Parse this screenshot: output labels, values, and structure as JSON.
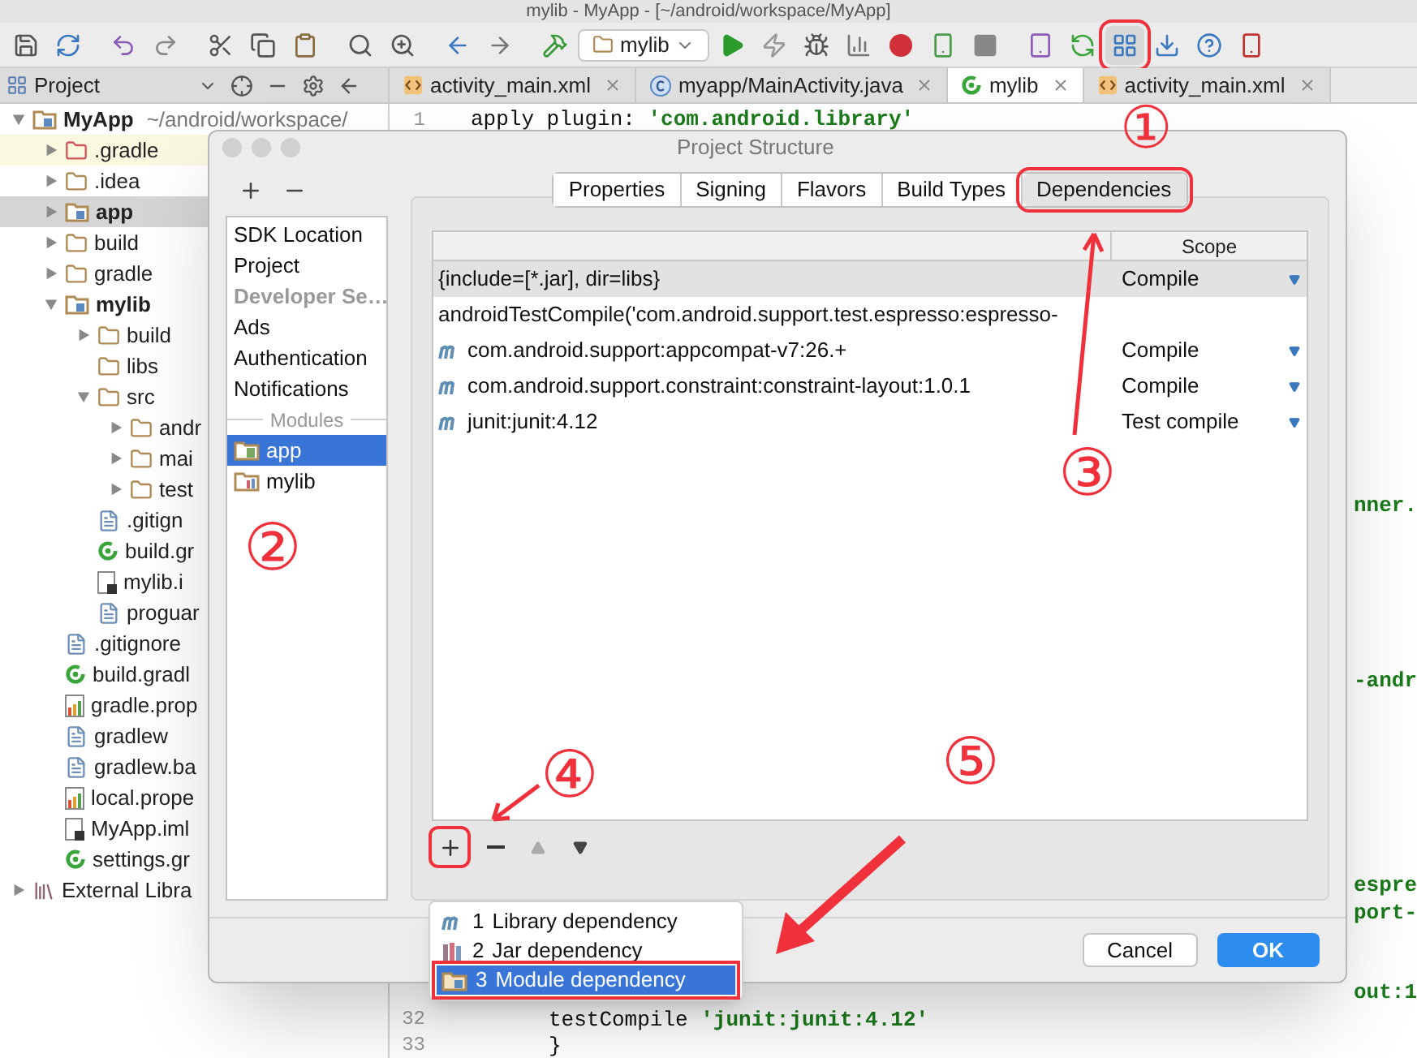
{
  "window": {
    "title": "mylib - MyApp - [~/android/workspace/MyApp]"
  },
  "toolbar": {
    "run_config": "mylib"
  },
  "project_panel": {
    "title": "Project"
  },
  "editor_tabs": [
    {
      "label": "activity_main.xml",
      "kind": "xml",
      "selected": false
    },
    {
      "label": "myapp/MainActivity.java",
      "kind": "java",
      "selected": false
    },
    {
      "label": "mylib",
      "kind": "gradle",
      "selected": true
    },
    {
      "label": "activity_main.xml",
      "kind": "xml",
      "selected": false
    }
  ],
  "tree": [
    {
      "label": "MyApp",
      "detail": "~/android/workspace/",
      "kind": "module",
      "expanded": true,
      "selected": false,
      "children": [
        {
          "label": ".gradle",
          "kind": "excluded",
          "expanded": false,
          "selected": false
        },
        {
          "label": ".idea",
          "kind": "folder",
          "expanded": false,
          "selected": false
        },
        {
          "label": "app",
          "kind": "module",
          "expanded": false,
          "selected": true
        },
        {
          "label": "build",
          "kind": "folder",
          "expanded": false,
          "selected": false
        },
        {
          "label": "gradle",
          "kind": "folder",
          "expanded": false,
          "selected": false
        },
        {
          "label": "mylib",
          "kind": "module",
          "expanded": true,
          "selected": false,
          "children": [
            {
              "label": "build",
              "kind": "folder",
              "expanded": false,
              "selected": false
            },
            {
              "label": "libs",
              "kind": "plainfolder",
              "selected": false
            },
            {
              "label": "src",
              "kind": "folder",
              "expanded": true,
              "selected": false,
              "children": [
                {
                  "label": "andr",
                  "kind": "folder",
                  "expanded": false,
                  "selected": false
                },
                {
                  "label": "mai",
                  "kind": "folder",
                  "expanded": false,
                  "selected": false
                },
                {
                  "label": "test",
                  "kind": "folder",
                  "expanded": false,
                  "selected": false
                }
              ]
            },
            {
              "label": ".gitign",
              "kind": "text",
              "selected": false
            },
            {
              "label": "build.gr",
              "kind": "gradle",
              "selected": false
            },
            {
              "label": "mylib.i",
              "kind": "iml",
              "selected": false
            },
            {
              "label": "proguar",
              "kind": "text",
              "selected": false
            }
          ]
        },
        {
          "label": ".gitignore",
          "kind": "text",
          "selected": false
        },
        {
          "label": "build.gradl",
          "kind": "gradle",
          "selected": false
        },
        {
          "label": "gradle.prop",
          "kind": "props",
          "selected": false
        },
        {
          "label": "gradlew",
          "kind": "text",
          "selected": false
        },
        {
          "label": "gradlew.ba",
          "kind": "text",
          "selected": false
        },
        {
          "label": "local.prope",
          "kind": "props",
          "selected": false
        },
        {
          "label": "MyApp.iml",
          "kind": "iml",
          "selected": false
        },
        {
          "label": "settings.gr",
          "kind": "gradle",
          "selected": false
        }
      ]
    },
    {
      "label": "External Libra",
      "kind": "library",
      "expanded": false,
      "selected": false
    }
  ],
  "editor": {
    "first_line": {
      "number": "1",
      "parts": [
        {
          "text": "apply plugin: ",
          "kind": "plain"
        },
        {
          "text": "'com.android.library'",
          "kind": "string"
        }
      ]
    },
    "fragments": [
      "nner.",
      "-andr",
      "espre",
      "port-",
      "out:1"
    ],
    "last_lines": [
      {
        "number": "32",
        "parts": [
          {
            "text": "testCompile ",
            "kind": "plain"
          },
          {
            "text": "'junit:junit:4.12'",
            "kind": "string"
          }
        ]
      },
      {
        "number": "33",
        "parts": [
          {
            "text": "}",
            "kind": "plain"
          }
        ]
      }
    ]
  },
  "dialog": {
    "title": "Project Structure",
    "nav": [
      {
        "label": "SDK Location",
        "kind": "item",
        "selected": false
      },
      {
        "label": "Project",
        "kind": "item",
        "selected": false
      },
      {
        "label": "Developer Se…",
        "kind": "header"
      },
      {
        "label": "Ads",
        "kind": "item",
        "selected": false
      },
      {
        "label": "Authentication",
        "kind": "item",
        "selected": false
      },
      {
        "label": "Notifications",
        "kind": "item",
        "selected": false
      },
      {
        "label": "Modules",
        "kind": "separator"
      },
      {
        "label": "app",
        "kind": "app-module",
        "selected": true
      },
      {
        "label": "mylib",
        "kind": "lib-module",
        "selected": false
      }
    ],
    "tabs": [
      {
        "label": "Properties",
        "selected": false,
        "highlighted": false
      },
      {
        "label": "Signing",
        "selected": false,
        "highlighted": false
      },
      {
        "label": "Flavors",
        "selected": false,
        "highlighted": false
      },
      {
        "label": "Build Types",
        "selected": false,
        "highlighted": false
      },
      {
        "label": "Dependencies",
        "selected": true,
        "highlighted": true
      }
    ],
    "table": {
      "scope_header": "Scope",
      "rows": [
        {
          "name": "{include=[*.jar], dir=libs}",
          "scope": "Compile",
          "kind": "plain",
          "selected": true
        },
        {
          "name": "androidTestCompile('com.android.support.test.espresso:espresso-",
          "kind": "plain",
          "selected": false
        },
        {
          "name": "com.android.support:appcompat-v7:26.+",
          "scope": "Compile",
          "kind": "maven",
          "selected": false
        },
        {
          "name": "com.android.support.constraint:constraint-layout:1.0.1",
          "scope": "Compile",
          "kind": "maven",
          "selected": false
        },
        {
          "name": "junit:junit:4.12",
          "scope": "Test compile",
          "kind": "maven",
          "selected": false
        }
      ]
    },
    "popup": [
      {
        "number": "1",
        "label": "Library dependency",
        "kind": "maven",
        "selected": false
      },
      {
        "number": "2",
        "label": "Jar dependency",
        "kind": "jar",
        "selected": false
      },
      {
        "number": "3",
        "label": "Module dependency",
        "kind": "module",
        "selected": true
      }
    ],
    "buttons": [
      {
        "label": "Cancel",
        "kind": "secondary"
      },
      {
        "label": "OK",
        "kind": "primary"
      }
    ]
  },
  "annotations": [
    "①",
    "②",
    "③",
    "④",
    "⑤"
  ]
}
